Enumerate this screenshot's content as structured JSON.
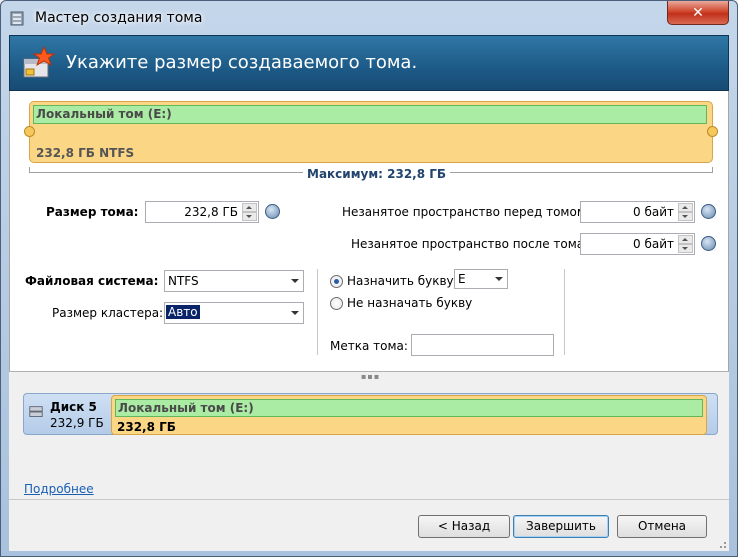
{
  "window": {
    "title": "Мастер создания тома",
    "close_symbol": "✕"
  },
  "header": {
    "title": "Укажите размер создаваемого тома."
  },
  "volume_bar": {
    "name": "Локальный том (E:)",
    "size_fs": "232,8 ГБ NTFS",
    "max_label": "Максимум: 232,8 ГБ"
  },
  "size": {
    "label": "Размер тома:",
    "value": "232,8 ГБ"
  },
  "space_before": {
    "label": "Незанятое пространство перед томом:",
    "value": "0 байт"
  },
  "space_after": {
    "label": "Незанятое пространство после тома:",
    "value": "0 байт"
  },
  "filesystem": {
    "label": "Файловая система:",
    "value": "NTFS"
  },
  "cluster": {
    "label": "Размер кластера:",
    "value": "Авто"
  },
  "letter": {
    "assign_label": "Назначить букву:",
    "assign_value": "E",
    "no_assign_label": "Не назначать букву",
    "selected": "assign"
  },
  "volume_label": {
    "label": "Метка тома:",
    "value": ""
  },
  "disk": {
    "name": "Диск 5",
    "size": "232,9 ГБ",
    "partition_name": "Локальный том (E:)",
    "partition_size": "232,8 ГБ"
  },
  "details_link": "Подробнее",
  "buttons": {
    "back": "< Назад",
    "finish": "Завершить",
    "cancel": "Отмена"
  },
  "colors": {
    "header_bg": "#1d5a87",
    "partition_fill": "#fbd685",
    "partition_name_fill": "#aaeca3",
    "link": "#1a5fb4"
  }
}
